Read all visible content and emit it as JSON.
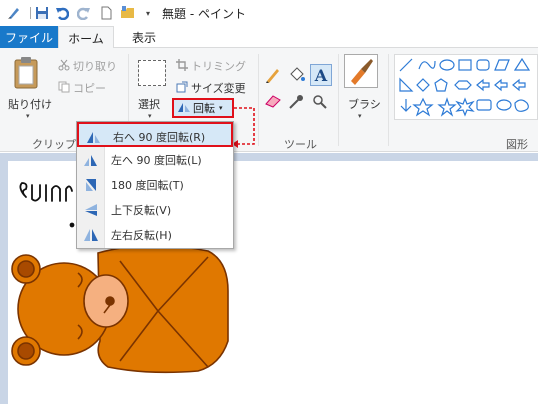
{
  "window": {
    "title": "無題 - ペイント"
  },
  "tabs": {
    "file": "ファイル",
    "home": "ホーム",
    "view": "表示"
  },
  "clipboard": {
    "paste": "貼り付け",
    "cut": "切り取り",
    "copy": "コピー",
    "label": "クリップボ"
  },
  "image": {
    "select": "選択",
    "crop": "トリミング",
    "resize": "サイズ変更",
    "rotate": "回転"
  },
  "tools": {
    "label": "ツール"
  },
  "brush": {
    "label": "ブラシ"
  },
  "shapes": {
    "label": "図形"
  },
  "rotate_menu": {
    "items": [
      {
        "label": "右へ 90 度回転(R)"
      },
      {
        "label": "左へ 90 度回転(L)"
      },
      {
        "label": "180 度回転(T)"
      },
      {
        "label": "上下反転(V)"
      },
      {
        "label": "左右反転(H)"
      }
    ]
  },
  "colors": {
    "accent": "#1979ca",
    "highlight_border": "#e0101a",
    "hover": "#d6e8f7",
    "bear_fill": "#e07800",
    "bear_outline": "#7a3300"
  }
}
